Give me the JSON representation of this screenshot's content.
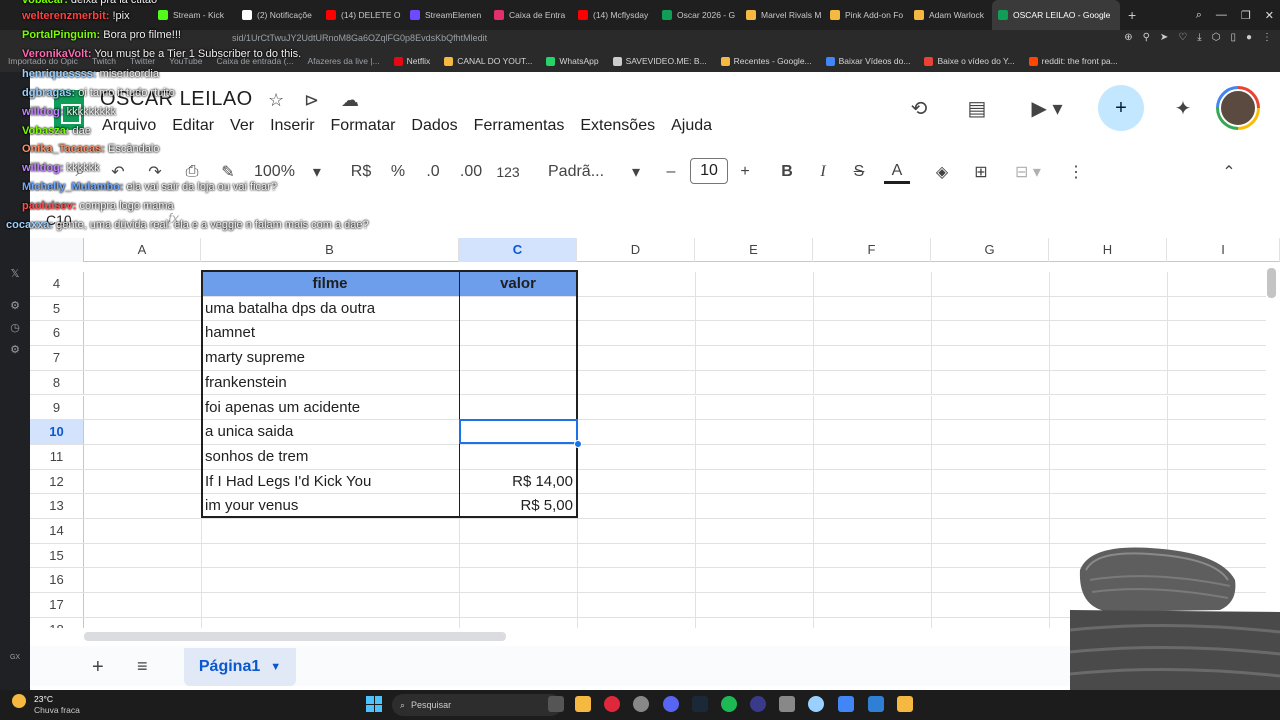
{
  "browser": {
    "tabs": [
      {
        "label": "Stream - Kick",
        "color": "#53fc18"
      },
      {
        "label": "(2) Notificaçõe",
        "color": "#ffffff"
      },
      {
        "label": "(14) DELETE O",
        "color": "#ff0000"
      },
      {
        "label": "StreamElemen",
        "color": "#6d4aff"
      },
      {
        "label": "Caixa de Entra",
        "color": "#e1306c"
      },
      {
        "label": "(14) Mcflysday",
        "color": "#ff0000"
      },
      {
        "label": "Oscar 2026 - G",
        "color": "#0f9d58"
      },
      {
        "label": "Marvel Rivals M",
        "color": "#f5b942"
      },
      {
        "label": "Pink Add-on Fo",
        "color": "#f5b942"
      },
      {
        "label": "Adam Warlock",
        "color": "#f5b942"
      }
    ],
    "active_tab": {
      "label": "OSCAR LEILAO - Google",
      "color": "#0f9d58"
    },
    "url": "sid/1UrCtTwuJY2UdtURnoM8Ga6OZqlFG0p8EvdsKbQfhtMledit",
    "bookmarks": [
      {
        "label": "Netflix",
        "color": "#e50914"
      },
      {
        "label": "CANAL DO YOUT...",
        "color": "#f5b942"
      },
      {
        "label": "WhatsApp",
        "color": "#25d366"
      },
      {
        "label": "SAVEVIDEO.ME: B...",
        "color": "#cccccc"
      },
      {
        "label": "Recentes - Google...",
        "color": "#f5b942"
      },
      {
        "label": "Baixar Vídeos do...",
        "color": "#4285f4"
      },
      {
        "label": "Baixe o vídeo do Y...",
        "color": "#ea4335"
      },
      {
        "label": "reddit: the front pa...",
        "color": "#ff4500"
      }
    ],
    "bookmarks_left": [
      "Importado do Opic",
      "Twitch",
      "Twitter",
      "YouTube",
      "Caixa de entrada (...",
      "Afazeres da live |..."
    ]
  },
  "sheet": {
    "title": "OSCAR LEILAO",
    "menu": [
      "Arquivo",
      "Editar",
      "Ver",
      "Inserir",
      "Formatar",
      "Dados",
      "Ferramentas",
      "Extensões",
      "Ajuda"
    ],
    "toolbar": {
      "zoom": "100%",
      "currency": "R$",
      "percent": "%",
      "dec_less": ".0",
      "dec_more": ".00",
      "number_format": "123",
      "font": "Padrã...",
      "font_size": "10"
    },
    "name_box": "C10",
    "fx": "fx",
    "columns": [
      "A",
      "B",
      "C",
      "D",
      "E",
      "F",
      "G",
      "H",
      "I"
    ],
    "selected_column": "C",
    "rows": [
      {
        "n": "4",
        "b": "filme",
        "c": "valor",
        "header": true
      },
      {
        "n": "5",
        "b": "uma batalha dps da outra",
        "c": ""
      },
      {
        "n": "6",
        "b": "hamnet",
        "c": ""
      },
      {
        "n": "7",
        "b": "marty supreme",
        "c": ""
      },
      {
        "n": "8",
        "b": "frankenstein",
        "c": ""
      },
      {
        "n": "9",
        "b": "foi apenas um acidente",
        "c": ""
      },
      {
        "n": "10",
        "b": "a unica saida",
        "c": "",
        "selected": true
      },
      {
        "n": "11",
        "b": "sonhos de trem",
        "c": ""
      },
      {
        "n": "12",
        "b": "If I Had Legs I'd Kick You",
        "c": "R$ 14,00"
      },
      {
        "n": "13",
        "b": "im your venus",
        "c": "R$ 5,00"
      },
      {
        "n": "14",
        "b": "",
        "c": ""
      },
      {
        "n": "15",
        "b": "",
        "c": ""
      },
      {
        "n": "16",
        "b": "",
        "c": ""
      },
      {
        "n": "17",
        "b": "",
        "c": ""
      },
      {
        "n": "18",
        "b": "",
        "c": ""
      }
    ],
    "sheet_tab": "Página1"
  },
  "chat": [
    {
      "user": "vobacar:",
      "msg": "deixa pra la ctitao",
      "color": "#7CFC00"
    },
    {
      "user": "welterenzmerbit:",
      "msg": "!pix",
      "color": "#ff4040"
    },
    {
      "user": "PortalPinguim:",
      "msg": "Bora pro filme!!!",
      "color": "#7CFC00"
    },
    {
      "user": "VeronikaVolt:",
      "msg": "You must be a Tier 1 Subscriber to do this.",
      "color": "#ff69b4"
    },
    {
      "user": "henriquessss:",
      "msg": "misericordia",
      "color": "#9ad0ff"
    },
    {
      "user": "dgbragas:",
      "msg": "oi tamo it tudo rtuito",
      "color": "#9ad0ff"
    },
    {
      "user": "willdog:",
      "msg": "kkkkkkkkk",
      "color": "#c080ff"
    },
    {
      "user": "Vobasza:",
      "msg": "dae",
      "color": "#7CFC00"
    },
    {
      "user": "Onika_Tacacas:",
      "msg": "Escândalo",
      "color": "#ff8c60"
    },
    {
      "user": "willdog:",
      "msg": "kkkkkk",
      "color": "#c080ff"
    },
    {
      "user": "Michelly_Mulambo:",
      "msg": "ela vai sair da loja ou vai ficar?",
      "color": "#6fa8ff"
    },
    {
      "user": "paoluisev:",
      "msg": "compra logo mama",
      "color": "#ff5050"
    },
    {
      "user": "cocaxxa:",
      "msg": "gente, uma dúvida real: ela e a veggie n falam mais com a dae?",
      "color": "#9ad0ff"
    }
  ],
  "taskbar": {
    "temp": "23°C",
    "weather": "Chuva fraca",
    "search_placeholder": "Pesquisar"
  }
}
